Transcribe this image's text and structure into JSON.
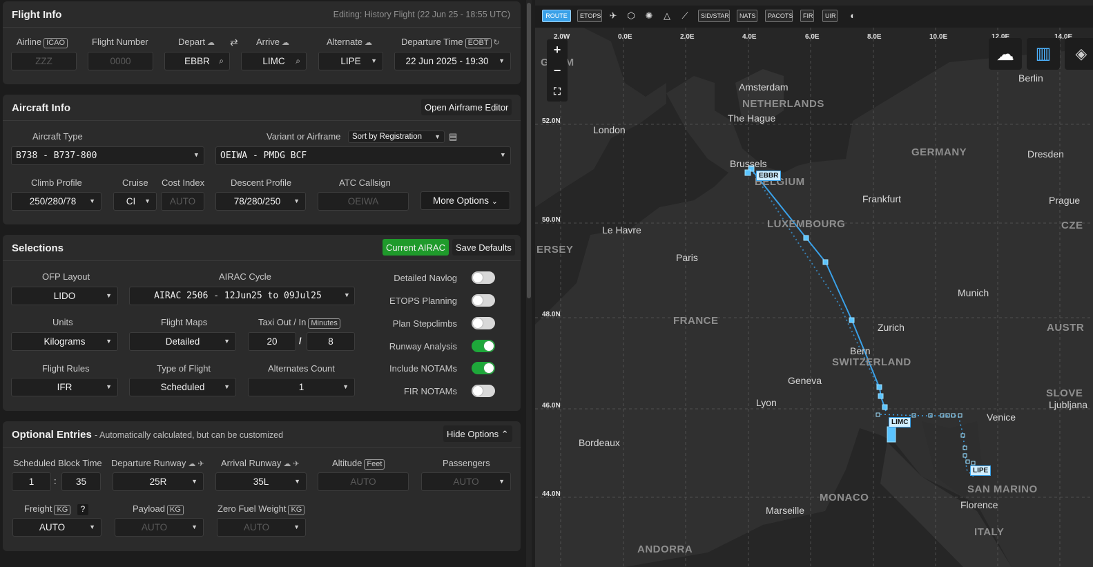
{
  "flight_info": {
    "title": "Flight Info",
    "editing": "Editing: History Flight (22 Jun 25 - 18:55 UTC)",
    "airline_label": "Airline",
    "airline_badge": "ICAO",
    "airline_placeholder": "ZZZ",
    "flight_number_label": "Flight Number",
    "flight_number_placeholder": "0000",
    "depart_label": "Depart",
    "depart_value": "EBBR",
    "arrive_label": "Arrive",
    "arrive_value": "LIMC",
    "alternate_label": "Alternate",
    "alternate_value": "LIPE",
    "departure_time_label": "Departure Time",
    "departure_time_badge": "EOBT",
    "departure_time_value": "22 Jun 2025 - 19:30"
  },
  "aircraft_info": {
    "title": "Aircraft Info",
    "open_editor": "Open Airframe Editor",
    "aircraft_type_label": "Aircraft Type",
    "aircraft_type_value": "B738 - B737-800",
    "variant_label": "Variant or Airframe",
    "sort_value": "Sort by Registration",
    "variant_value": "OEIWA - PMDG BCF",
    "climb_label": "Climb Profile",
    "climb_value": "250/280/78",
    "cruise_label": "Cruise",
    "cruise_value": "CI",
    "cost_index_label": "Cost Index",
    "cost_index_placeholder": "AUTO",
    "descent_label": "Descent Profile",
    "descent_value": "78/280/250",
    "callsign_label": "ATC Callsign",
    "callsign_placeholder": "OEIWA",
    "more_options": "More Options"
  },
  "selections": {
    "title": "Selections",
    "current_airac": "Current AIRAC",
    "save_defaults": "Save Defaults",
    "ofp_label": "OFP Layout",
    "ofp_value": "LIDO",
    "airac_label": "AIRAC Cycle",
    "airac_value": "AIRAC 2506 - 12Jun25 to 09Jul25",
    "units_label": "Units",
    "units_value": "Kilograms",
    "maps_label": "Flight Maps",
    "maps_value": "Detailed",
    "taxi_label": "Taxi Out / In",
    "taxi_badge": "Minutes",
    "taxi_out": "20",
    "taxi_sep": "/",
    "taxi_in": "8",
    "rules_label": "Flight Rules",
    "rules_value": "IFR",
    "type_label": "Type of Flight",
    "type_value": "Scheduled",
    "alternates_label": "Alternates Count",
    "alternates_value": "1",
    "toggles": [
      {
        "label": "Detailed Navlog",
        "on": false
      },
      {
        "label": "ETOPS Planning",
        "on": false
      },
      {
        "label": "Plan Stepclimbs",
        "on": false
      },
      {
        "label": "Runway Analysis",
        "on": true
      },
      {
        "label": "Include NOTAMs",
        "on": true
      },
      {
        "label": "FIR NOTAMs",
        "on": false
      }
    ]
  },
  "optional": {
    "title": "Optional Entries",
    "subtitle": "- Automatically calculated, but can be customized",
    "hide_options": "Hide Options",
    "block_label": "Scheduled Block Time",
    "block_h": "1",
    "block_sep": ":",
    "block_m": "35",
    "dep_rwy_label": "Departure Runway",
    "dep_rwy_value": "25R",
    "arr_rwy_label": "Arrival Runway",
    "arr_rwy_value": "35L",
    "altitude_label": "Altitude",
    "altitude_badge": "Feet",
    "altitude_placeholder": "AUTO",
    "pax_label": "Passengers",
    "pax_placeholder": "AUTO",
    "freight_label": "Freight",
    "freight_badge": "KG",
    "freight_help": "?",
    "freight_value": "AUTO",
    "payload_label": "Payload",
    "payload_badge": "KG",
    "payload_value": "AUTO",
    "zfw_label": "Zero Fuel Weight",
    "zfw_badge": "KG",
    "zfw_value": "AUTO"
  },
  "map": {
    "toolbar": [
      "ROUTE",
      "ETOPS",
      "SID/STAR",
      "NATS",
      "PACOTS",
      "FIR",
      "UIR"
    ],
    "lon_labels": [
      "2.0W",
      "0.0E",
      "2.0E",
      "4.0E",
      "6.0E",
      "8.0E",
      "10.0E",
      "12.0E",
      "14.0E"
    ],
    "lat_labels": [
      "52.0N",
      "50.0N",
      "48.0N",
      "46.0N",
      "44.0N"
    ],
    "cities": [
      "Amsterdam",
      "The Hague",
      "London",
      "Brussels",
      "Berlin",
      "Dresden",
      "Frankfurt",
      "Prague",
      "Le Havre",
      "Paris",
      "Munich",
      "Zurich",
      "Bern",
      "Geneva",
      "Lyon",
      "Bordeaux",
      "Venice",
      "Ljubljana",
      "Florence",
      "Marseille"
    ],
    "countries": [
      "NETHERLANDS",
      "GERMANY",
      "LUXEMBOURG",
      "FRANCE",
      "SWITZERLAND",
      "MONACO",
      "SAN MARINO",
      "ITALY",
      "ANDORRA",
      "BELGIUM",
      "GDOM",
      "ERSEY",
      "CZE",
      "AUSTR",
      "SLOVE"
    ],
    "route_labels": [
      "EBBR",
      "LIMC",
      "LIPE"
    ]
  }
}
